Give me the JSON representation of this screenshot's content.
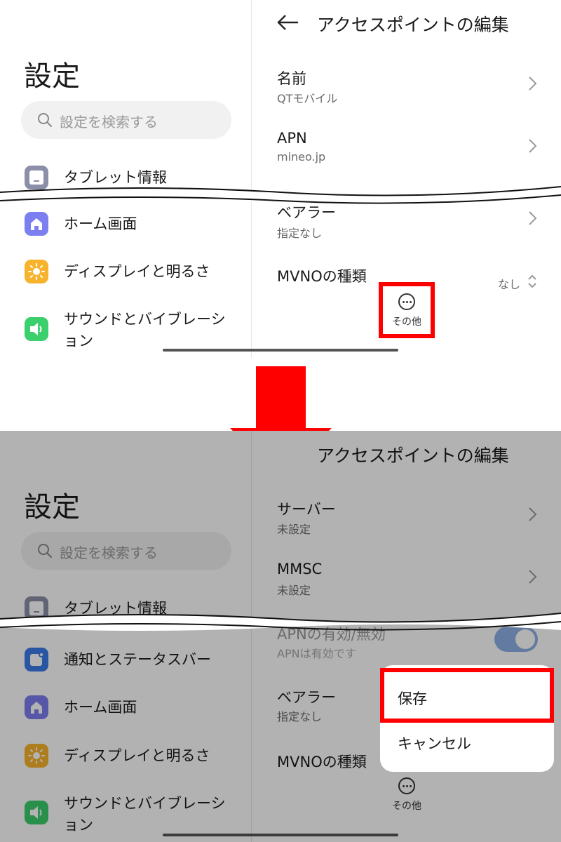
{
  "top": {
    "settings_title": "設定",
    "search_placeholder": "設定を検索する",
    "menu": [
      {
        "label": "タブレット情報",
        "icon": "tablet-icon",
        "color": "#8b90a8"
      },
      {
        "label": "ホーム画面",
        "icon": "home-icon",
        "color": "#7b7ff0"
      },
      {
        "label": "ディスプレイと明るさ",
        "icon": "sun-icon",
        "color": "#f8b32c"
      },
      {
        "label": "サウンドとバイブレーション",
        "icon": "speaker-icon",
        "color": "#3ccf6e"
      }
    ],
    "ap_title": "アクセスポイントの編集",
    "ap_items": [
      {
        "name": "名前",
        "value": "QTモバイル"
      },
      {
        "name": "APN",
        "value": "mineo.jp"
      },
      {
        "name": "ベアラー",
        "value": "指定なし"
      },
      {
        "name": "MVNOの種類",
        "value": "なし"
      }
    ],
    "more_label": "その他"
  },
  "bottom": {
    "settings_title": "設定",
    "search_placeholder": "設定を検索する",
    "menu": [
      {
        "label": "タブレット情報",
        "icon": "tablet-icon",
        "color": "#8b90a8"
      },
      {
        "label": "通知とステータスバー",
        "icon": "notification-icon",
        "color": "#3a7be8"
      },
      {
        "label": "ホーム画面",
        "icon": "home-icon",
        "color": "#7b7ff0"
      },
      {
        "label": "ディスプレイと明るさ",
        "icon": "sun-icon",
        "color": "#f8b32c"
      },
      {
        "label": "サウンドとバイブレーション",
        "icon": "speaker-icon",
        "color": "#3ccf6e"
      }
    ],
    "ap_title": "アクセスポイントの編集",
    "ap_items": [
      {
        "name": "サーバー",
        "value": "未設定"
      },
      {
        "name": "MMSC",
        "value": "未設定"
      },
      {
        "name": "APNの有効/無効",
        "value": "APNは有効です"
      },
      {
        "name": "ベアラー",
        "value": "指定なし"
      },
      {
        "name": "MVNOの種類",
        "value": ""
      }
    ],
    "apn_toggle_on": true,
    "more_label": "その他",
    "popup": {
      "save": "保存",
      "cancel": "キャンセル"
    }
  },
  "colors": {
    "highlight": "#ff0000",
    "arrow": "#ff0000",
    "toggle": "#8fb0e6"
  }
}
